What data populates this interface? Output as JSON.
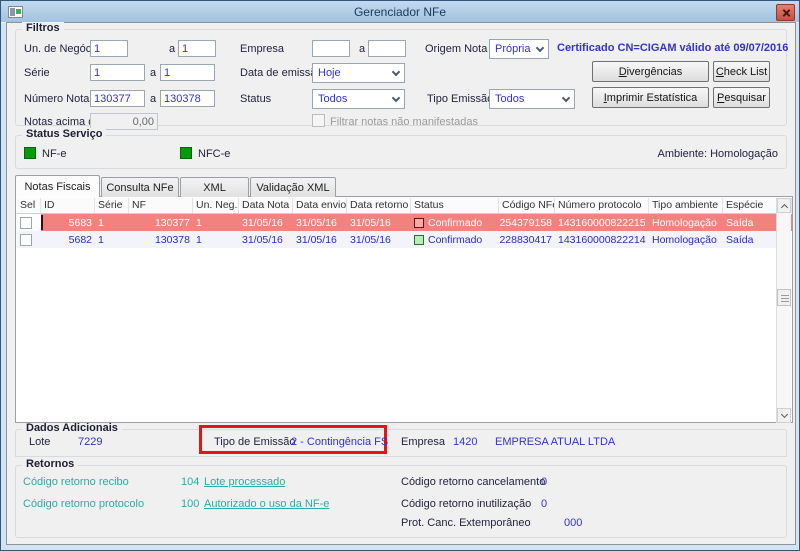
{
  "window": {
    "title": "Gerenciador NFe"
  },
  "filters": {
    "legend": "Filtros",
    "conj": "a",
    "un_negocio": {
      "label": "Un. de Negócio",
      "from": "1",
      "to": "1"
    },
    "empresa": {
      "label": "Empresa",
      "from": "",
      "to": ""
    },
    "origem_nota": {
      "label": "Origem Nota",
      "value": "Própria"
    },
    "certificado": "Certificado CN=CIGAM válido até 09/07/2016",
    "serie": {
      "label": "Série",
      "from": "1",
      "to": "1"
    },
    "data_emissao": {
      "label": "Data de emissão",
      "value": "Hoje"
    },
    "numero_nota": {
      "label": "Número Nota",
      "from": "130377",
      "to": "130378"
    },
    "status": {
      "label": "Status",
      "value": "Todos"
    },
    "tipo_emissao": {
      "label": "Tipo Emissão",
      "value": "Todos"
    },
    "notas_acima": {
      "label": "Notas acima de",
      "value": "0,00"
    },
    "filtrar_label": "Filtrar notas não manifestadas",
    "buttons": {
      "divergencias": {
        "m": "D",
        "rest": "ivergências"
      },
      "check_list": {
        "m": "C",
        "rest": "heck List"
      },
      "imprimir": {
        "m": "I",
        "rest": "mprimir Estatística"
      },
      "pesquisar": {
        "m": "P",
        "rest": "esquisar"
      }
    }
  },
  "status_servico": {
    "legend": "Status Serviço",
    "nfe_label": "NF-e",
    "nfce_label": "NFC-e",
    "ambiente": "Ambiente: Homologação"
  },
  "tabs": {
    "notas_fiscais": "Notas Fiscais",
    "consulta_nfe": "Consulta NFe",
    "xml": "XML",
    "validacao_xml": "Validação XML"
  },
  "grid": {
    "columns": [
      "Sel",
      "ID",
      "Série",
      "NF",
      "Un. Neg.",
      "Data Nota",
      "Data envio",
      "Data retorno",
      "Status",
      "Código NFe",
      "Número protocolo",
      "Tipo ambiente",
      "Espécie"
    ],
    "rows": [
      {
        "id": "5683",
        "serie": "1",
        "nf": "130377",
        "un_neg": "1",
        "data_nota": "31/05/16",
        "data_envio": "31/05/16",
        "data_retorno": "31/05/16",
        "status": "Confirmado",
        "codigo_nfe": "254379158",
        "numero_protocolo": "143160000822215",
        "tipo_ambiente": "Homologação",
        "especie": "Saída"
      },
      {
        "id": "5682",
        "serie": "1",
        "nf": "130378",
        "un_neg": "1",
        "data_nota": "31/05/16",
        "data_envio": "31/05/16",
        "data_retorno": "31/05/16",
        "status": "Confirmado",
        "codigo_nfe": "228830417",
        "numero_protocolo": "143160000822214",
        "tipo_ambiente": "Homologação",
        "especie": "Saída"
      }
    ]
  },
  "dados_adicionais": {
    "legend": "Dados Adicionais",
    "lote_label": "Lote",
    "lote_value": "7229",
    "tipo_emissao_label": "Tipo de Emissão",
    "tipo_emissao_value": "2 - Contingência FS",
    "empresa_label": "Empresa",
    "empresa_code": "1420",
    "empresa_name": "EMPRESA ATUAL LTDA"
  },
  "retornos": {
    "legend": "Retornos",
    "recibo_label": "Código retorno recibo",
    "recibo_code": "104",
    "recibo_link": "Lote processado",
    "protocolo_label": "Código retorno protocolo",
    "protocolo_code": "100",
    "protocolo_link": "Autorizado o uso da NF-e",
    "cancelamento_label": "Código retorno cancelamento",
    "cancelamento_value": "0",
    "inutilizacao_label": "Código retorno inutilização",
    "inutilizacao_value": "0",
    "extemporaneo_label": "Prot. Canc. Extemporâneo",
    "extemporaneo_value": "000"
  },
  "colors": {
    "value_blue": "#3333cc",
    "retorno_teal": "#2faaa6",
    "selected_row": "#f2827e",
    "service_green": "#089a0d",
    "highlight_red": "#e51515"
  }
}
